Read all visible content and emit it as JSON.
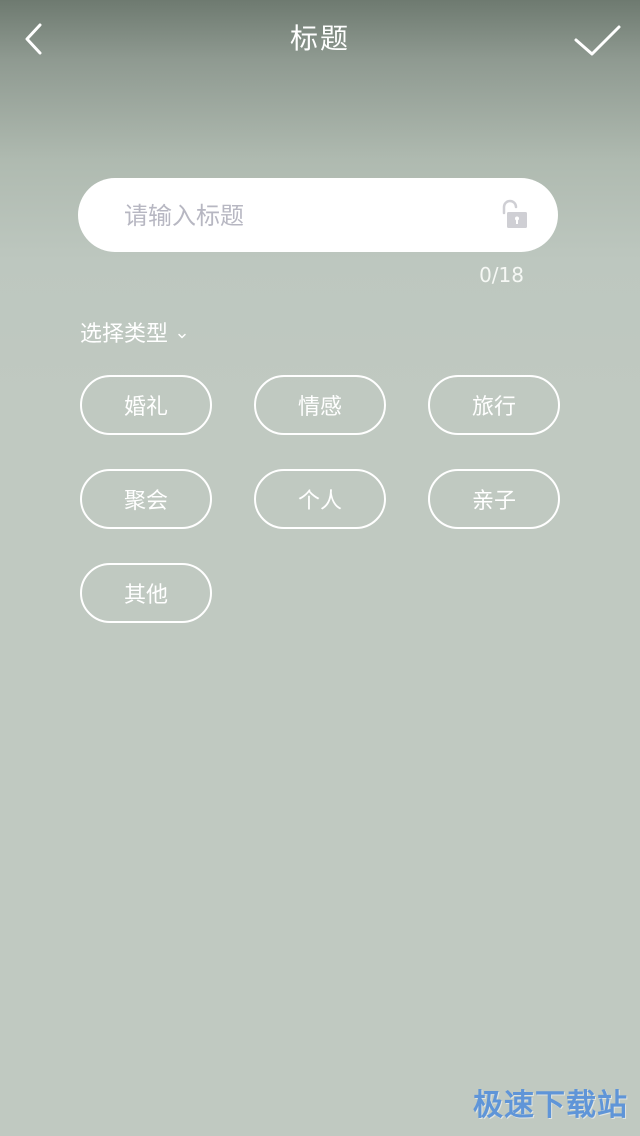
{
  "header": {
    "title": "标题",
    "back_icon": "chevron-left-icon",
    "confirm_icon": "checkmark-icon"
  },
  "title_input": {
    "placeholder": "请输入标题",
    "value": "",
    "lock_icon": "unlocked-padlock-icon",
    "char_count": "0/18"
  },
  "type_section": {
    "label": "选择类型",
    "dropdown_icon": "chevron-down-icon",
    "types": [
      "婚礼",
      "情感",
      "旅行",
      "聚会",
      "个人",
      "亲子",
      "其他"
    ]
  },
  "watermark": {
    "text": "极速下载站",
    "color": "#5f95d8"
  },
  "colors": {
    "background": "#c0c9c1",
    "header_gradient_top": "#6e7a70",
    "foreground": "#ffffff",
    "placeholder": "#b7b7c2"
  }
}
